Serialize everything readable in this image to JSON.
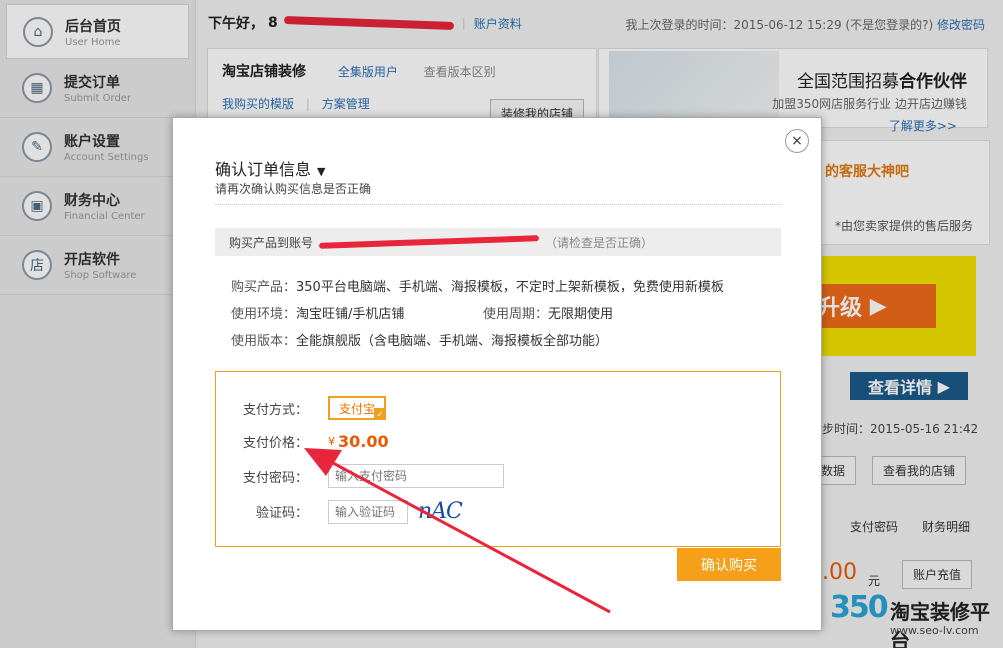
{
  "sidebar": {
    "items": [
      {
        "label": "后台首页",
        "sub": "User Home"
      },
      {
        "label": "提交订单",
        "sub": "Submit Order"
      },
      {
        "label": "账户设置",
        "sub": "Account Settings"
      },
      {
        "label": "财务中心",
        "sub": "Financial Center"
      },
      {
        "label": "开店软件",
        "sub": "Shop Software"
      }
    ]
  },
  "header": {
    "greeting": "下午好，",
    "account_name_visible": "8",
    "account_link": "账户资料",
    "last_login": "我上次登录的时间：2015-06-12 15:29 (不是您登录的?)",
    "change_password": "修改密码"
  },
  "shop_panel": {
    "title": "淘宝店铺装修",
    "edition": "全集版用户",
    "compare": "查看版本区别",
    "my_templates": "我购买的模版",
    "plan_manage": "方案管理",
    "decorate_btn": "装修我的店铺"
  },
  "ad_panel": {
    "title_a": "全国范围招募",
    "title_b": "合作伙伴",
    "sub": "加盟350网店服务行业 边开店边赚钱",
    "more": "了解更多>>"
  },
  "service_panel": {
    "text": "的客服大神吧",
    "note": "*由您卖家提供的售后服务"
  },
  "upgrade_banner": {
    "text": "升级"
  },
  "details_btn": {
    "text": "查看详情"
  },
  "sync": {
    "text": "步时间：2015-05-16 21:42"
  },
  "data_btn": {
    "text": "数据"
  },
  "view_shop_btn": {
    "text": "查看我的店铺"
  },
  "finance_links": {
    "pay_pwd": "支付密码",
    "finance_detail": "财务明细"
  },
  "balance": {
    "amount": ".00",
    "unit": "元",
    "recharge": "账户充值"
  },
  "brand": {
    "num": "350",
    "name": "淘宝装修平台",
    "url": "www.seo-lv.com"
  },
  "modal": {
    "title": "确认订单信息",
    "subtitle": "请再次确认购买信息是否正确",
    "account_prefix": "购买产品到账号",
    "account_hint": "（请检查是否正确）",
    "product_label": "购买产品：",
    "product_value": "350平台电脑端、手机端、海报模板，不定时上架新模板，免费使用新模板",
    "env_label": "使用环境：",
    "env_value": "淘宝旺铺/手机店铺",
    "period_label": "使用周期：",
    "period_value": "无限期使用",
    "version_label": "使用版本：",
    "version_value": "全能旗舰版（含电脑端、手机端、海报模板全部功能）",
    "pay_method_label": "支付方式：",
    "pay_method_value": "支付宝",
    "price_label": "支付价格：",
    "price_currency": "¥",
    "price_value": "30.00",
    "password_label": "支付密码：",
    "password_placeholder": "输入支付密码",
    "captcha_label": "验证码：",
    "captcha_placeholder": "输入验证码",
    "captcha_text": "nAC",
    "confirm_btn": "确认购买",
    "close": "×"
  }
}
